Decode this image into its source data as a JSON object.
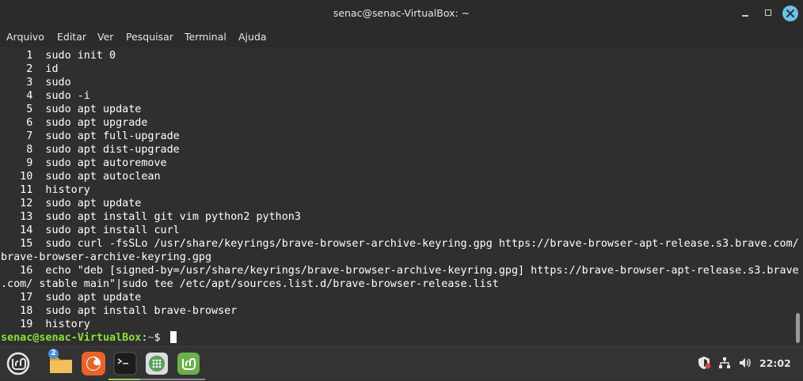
{
  "window": {
    "title": "senac@senac-VirtualBox: ~"
  },
  "menu": {
    "items": [
      "Arquivo",
      "Editar",
      "Ver",
      "Pesquisar",
      "Terminal",
      "Ajuda"
    ]
  },
  "terminal": {
    "lines": [
      "    1  sudo init 0",
      "    2  id",
      "    3  sudo",
      "    4  sudo -i",
      "    5  sudo apt update",
      "    6  sudo apt upgrade",
      "    7  sudo apt full-upgrade",
      "    8  sudo apt dist-upgrade",
      "    9  sudo apt autoremove",
      "   10  sudo apt autoclean",
      "   11  history",
      "   12  sudo apt update",
      "   13  sudo apt install git vim python2 python3",
      "   14  sudo apt install curl",
      "   15  sudo curl -fsSLo /usr/share/keyrings/brave-browser-archive-keyring.gpg https://brave-browser-apt-release.s3.brave.com/",
      "brave-browser-archive-keyring.gpg",
      "   16  echo \"deb [signed-by=/usr/share/keyrings/brave-browser-archive-keyring.gpg] https://brave-browser-apt-release.s3.brave",
      ".com/ stable main\"|sudo tee /etc/apt/sources.list.d/brave-browser-release.list",
      "   17  sudo apt update",
      "   18  sudo apt install brave-browser",
      "   19  history"
    ],
    "prompt": {
      "user_host": "senac@senac-VirtualBox",
      "separator": ":",
      "path": "~",
      "symbol": "$ "
    }
  },
  "taskbar": {
    "files_badge": "2",
    "clock": "22:02",
    "icons": [
      "mint-menu-icon",
      "folder-icon",
      "firefox-icon",
      "terminal-icon",
      "apps-grid-icon",
      "mint-update-icon"
    ],
    "tray_icons": [
      "shield-icon",
      "network-icon",
      "volume-icon"
    ]
  }
}
